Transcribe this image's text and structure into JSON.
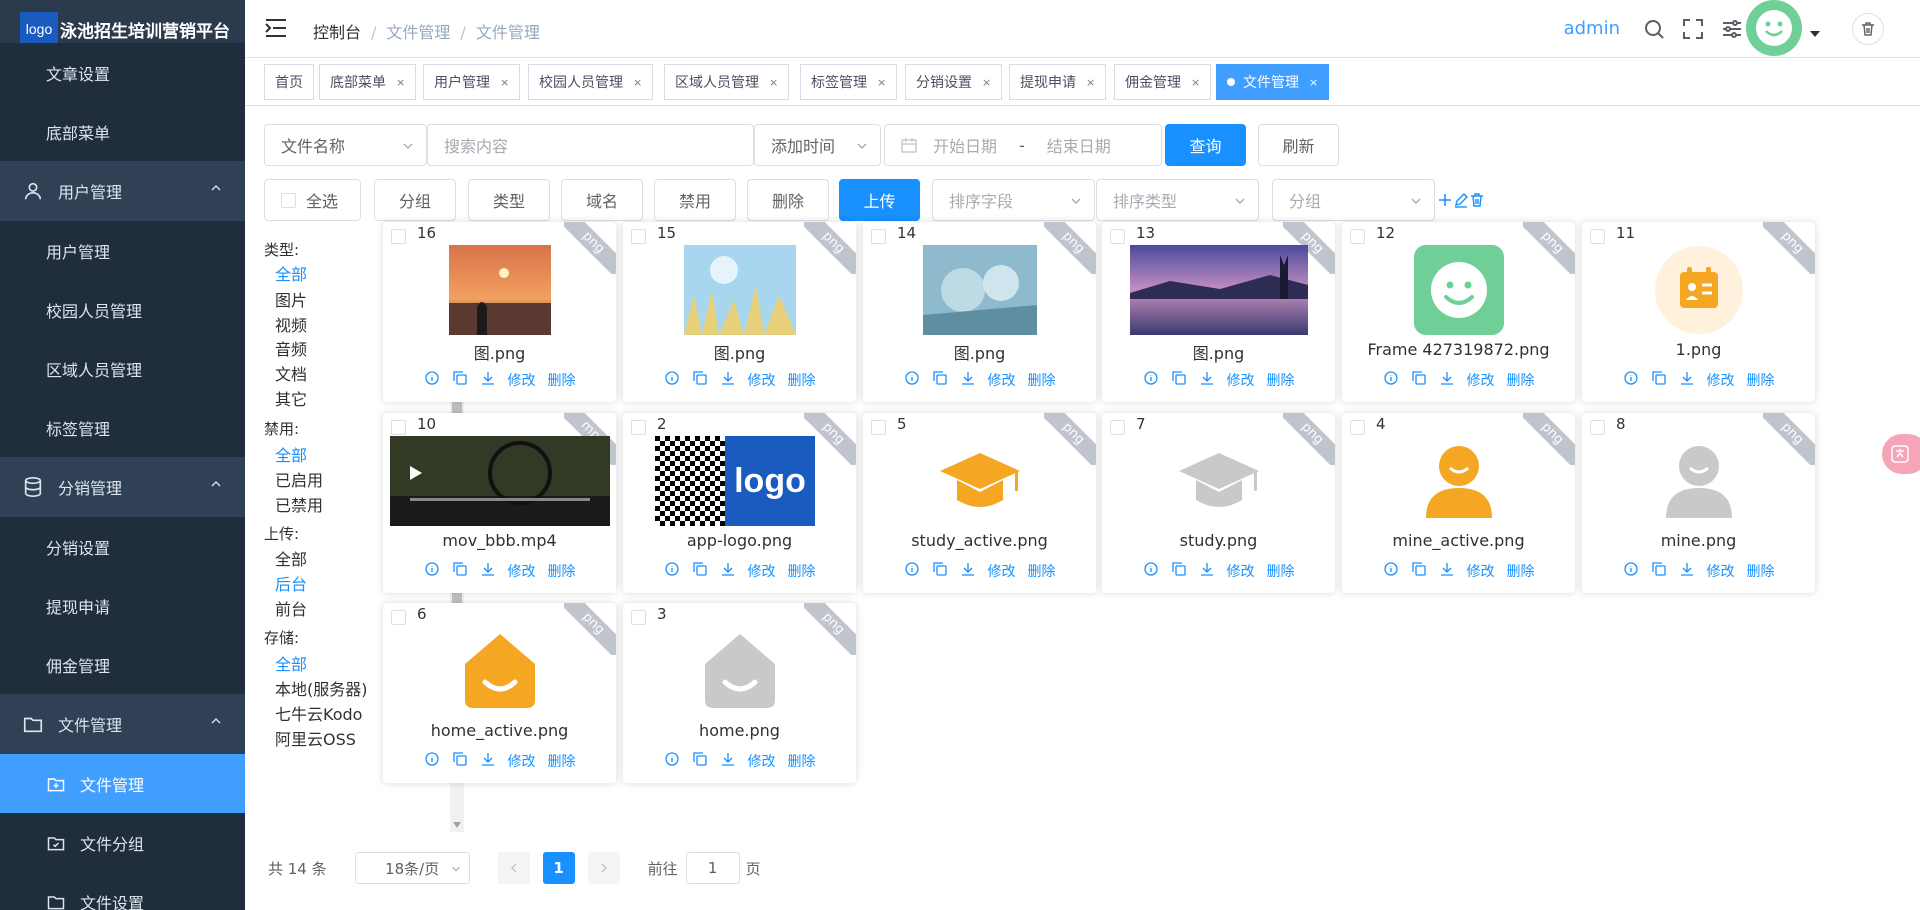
{
  "app": {
    "logo_text": "logo",
    "title": "泳池招生培训营销平台"
  },
  "sidebar": {
    "top_items": [
      {
        "label": "文章设置"
      },
      {
        "label": "底部菜单"
      }
    ],
    "groups": [
      {
        "label": "用户管理",
        "icon": "user-icon",
        "items": [
          {
            "label": "用户管理"
          },
          {
            "label": "校园人员管理"
          },
          {
            "label": "区域人员管理"
          },
          {
            "label": "标签管理"
          }
        ]
      },
      {
        "label": "分销管理",
        "icon": "database-icon",
        "items": [
          {
            "label": "分销设置"
          },
          {
            "label": "提现申请"
          },
          {
            "label": "佣金管理"
          }
        ]
      },
      {
        "label": "文件管理",
        "icon": "folder-icon",
        "items": [
          {
            "label": "文件管理",
            "active": true
          },
          {
            "label": "文件分组"
          },
          {
            "label": "文件设置"
          }
        ]
      }
    ]
  },
  "header": {
    "breadcrumbs": [
      "控制台",
      "文件管理",
      "文件管理"
    ],
    "user": "admin",
    "breadcrumb_sep": "/"
  },
  "tags": [
    {
      "label": "首页",
      "closable": false
    },
    {
      "label": "底部菜单",
      "closable": true
    },
    {
      "label": "用户管理",
      "closable": true
    },
    {
      "label": "校园人员管理",
      "closable": true
    },
    {
      "label": "区域人员管理",
      "closable": true
    },
    {
      "label": "标签管理",
      "closable": true
    },
    {
      "label": "分销设置",
      "closable": true
    },
    {
      "label": "提现申请",
      "closable": true
    },
    {
      "label": "佣金管理",
      "closable": true
    },
    {
      "label": "文件管理",
      "closable": true,
      "active": true
    }
  ],
  "tag_close": "×",
  "search": {
    "field_select": "文件名称",
    "keyword_placeholder": "搜索内容",
    "time_select": "添加时间",
    "start_placeholder": "开始日期",
    "range_sep": "-",
    "end_placeholder": "结束日期",
    "query_btn": "查询",
    "refresh_btn": "刷新"
  },
  "toolbar": {
    "select_all": "全选",
    "group_btn": "分组",
    "type_btn": "类型",
    "domain_btn": "域名",
    "disable_btn": "禁用",
    "delete_btn": "删除",
    "upload_btn": "上传",
    "sort_field_placeholder": "排序字段",
    "sort_type_placeholder": "排序类型",
    "group_placeholder": "分组"
  },
  "filters": [
    {
      "title": "类型:",
      "options": [
        {
          "label": "全部",
          "selected": true
        },
        {
          "label": "图片"
        },
        {
          "label": "视频"
        },
        {
          "label": "音频"
        },
        {
          "label": "文档"
        },
        {
          "label": "其它"
        }
      ]
    },
    {
      "title": "禁用:",
      "options": [
        {
          "label": "全部",
          "selected": true
        },
        {
          "label": "已启用"
        },
        {
          "label": "已禁用"
        }
      ]
    },
    {
      "title": "上传:",
      "options": [
        {
          "label": "全部"
        },
        {
          "label": "后台",
          "selected": true
        },
        {
          "label": "前台"
        }
      ]
    },
    {
      "title": "存储:",
      "options": [
        {
          "label": "全部",
          "selected": true
        },
        {
          "label": "本地(服务器)"
        },
        {
          "label": "七牛云Kodo"
        },
        {
          "label": "阿里云OSS"
        }
      ]
    }
  ],
  "card_actions": {
    "edit": "修改",
    "delete": "删除"
  },
  "files": [
    {
      "id": "16",
      "name": "图.png",
      "ext": "png",
      "thumb": "sunset"
    },
    {
      "id": "15",
      "name": "图.png",
      "ext": "png",
      "thumb": "grass"
    },
    {
      "id": "14",
      "name": "图.png",
      "ext": "png",
      "thumb": "ice"
    },
    {
      "id": "13",
      "name": "图.png",
      "ext": "png",
      "thumb": "lake"
    },
    {
      "id": "12",
      "name": "Frame 427319872.png",
      "ext": "png",
      "thumb": "smile"
    },
    {
      "id": "11",
      "name": "1.png",
      "ext": "png",
      "thumb": "card-icon"
    },
    {
      "id": "10",
      "name": "mov_bbb.mp4",
      "ext": "mp4",
      "thumb": "video"
    },
    {
      "id": "2",
      "name": "app-logo.png",
      "ext": "png",
      "thumb": "logo"
    },
    {
      "id": "5",
      "name": "study_active.png",
      "ext": "png",
      "thumb": "cap-orange"
    },
    {
      "id": "7",
      "name": "study.png",
      "ext": "png",
      "thumb": "cap-gray"
    },
    {
      "id": "4",
      "name": "mine_active.png",
      "ext": "png",
      "thumb": "person-orange"
    },
    {
      "id": "8",
      "name": "mine.png",
      "ext": "png",
      "thumb": "person-gray"
    },
    {
      "id": "6",
      "name": "home_active.png",
      "ext": "png",
      "thumb": "home-orange"
    },
    {
      "id": "3",
      "name": "home.png",
      "ext": "png",
      "thumb": "home-gray"
    }
  ],
  "pagination": {
    "total": "共 14 条",
    "page_size": "18条/页",
    "current": "1",
    "goto_label": "前往",
    "goto_value": "1",
    "page_unit": "页"
  },
  "colors": {
    "primary": "#1890ff",
    "sidebar": "#304156",
    "orange": "#f5a623",
    "gray": "#c9c9c9",
    "green": "#6fcf97"
  }
}
